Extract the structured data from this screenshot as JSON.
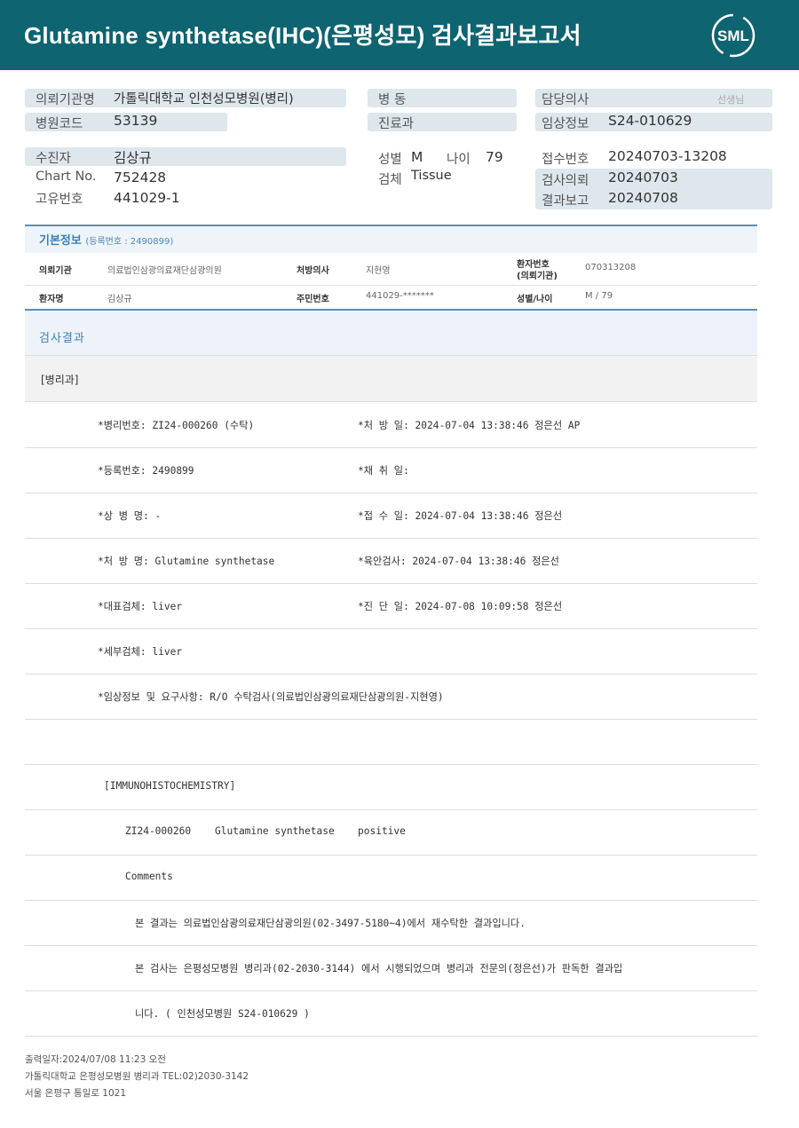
{
  "header": {
    "title": "Glutamine  synthetase(IHC)(은평성모) 검사결과보고서",
    "logo_text": "SML",
    "color": "#0e6470"
  },
  "info": {
    "req_inst_label": "의뢰기관명",
    "req_inst_value": "가톨릭대학교 인천성모병원(병리)",
    "hosp_code_label": "병원코드",
    "hosp_code_value": "53139",
    "ward_label": "병  동",
    "ward_value": "",
    "dept_label": "진료과",
    "dept_value": "",
    "doctor_label": "담당의사",
    "doctor_suffix": "선생님",
    "clinical_label": "임상정보",
    "clinical_value": "S24-010629",
    "patient_label": "수진자",
    "patient_value": "김상규",
    "chart_label": "Chart No.",
    "chart_value": "752428",
    "unique_label": "고유번호",
    "unique_value": "441029-1",
    "sex_label": "성별",
    "sex_value": "M",
    "age_label": "나이",
    "age_value": "79",
    "specimen_label": "검체",
    "specimen_value": "Tissue",
    "receipt_label": "접수번호",
    "receipt_value": "20240703-13208",
    "request_label": "검사의뢰",
    "request_value": "20240703",
    "report_label": "결과보고",
    "report_value": "20240708"
  },
  "basic": {
    "title": "기본정보",
    "subtitle": "(등록번호 : 2490899)",
    "inst_label": "의뢰기관",
    "inst_value": "의료법인삼광의료재단삼광의원",
    "presc_label": "처방의사",
    "presc_value": "지현영",
    "pt_no_label_1": "환자번호",
    "pt_no_label_2": "(의뢰기관)",
    "pt_no_value": "070313208",
    "name_label": "환자명",
    "name_value": "김상규",
    "rrn_label": "주민번호",
    "rrn_value": "441029-*******",
    "sexage_label": "성별/나이",
    "sexage_value": "M / 79"
  },
  "result": {
    "title": "검사결과",
    "dept": "[병리과]",
    "rows": [
      {
        "left": "*병리번호: ZI24-000260 (수탁)",
        "right": "*처 방 일: 2024-07-04 13:38:46  정은선 AP"
      },
      {
        "left": "*등록번호: 2490899",
        "right": "*채 취 일:"
      },
      {
        "left": "*상 병 명: -",
        "right": "*접 수 일: 2024-07-04 13:38:46  정은선"
      },
      {
        "left": "*처 방 명: Glutamine synthetase",
        "right": "*육안검사: 2024-07-04 13:38:46  정은선"
      },
      {
        "left": "*대표검체: liver",
        "right": "*진 단 일: 2024-07-08 10:09:58  정은선"
      },
      {
        "left": "*세부검체: liver",
        "right": ""
      },
      {
        "left": "*임상정보 및 요구사항: R/O 수탁검사(의료법인삼광의료재단삼광의원-지현영)",
        "right": ""
      }
    ],
    "ihc_header": "[IMMUNOHISTOCHEMISTRY]",
    "ihc_id": "ZI24-000260",
    "ihc_test": "Glutamine synthetase",
    "ihc_result": "positive",
    "comments_label": "Comments",
    "comment1": "본 결과는 의료법인삼광의료재단삼광의원(02-3497-5180~4)에서 재수탁한 결과입니다.",
    "comment2": "본 검사는 은평성모병원 병리과(02-2030-3144) 에서 시행되었으며 병리과 전문의(정은선)가 판독한 결과입",
    "comment3": "니다. ( 인천성모병원 S24-010629 )"
  },
  "footer": {
    "printed": "출력일자:2024/07/08 11:23 오전",
    "hospital": "가톨릭대학교 은평성모병원 병리과 TEL:02)2030-3142",
    "address": "서울 은평구 통일로 1021"
  }
}
